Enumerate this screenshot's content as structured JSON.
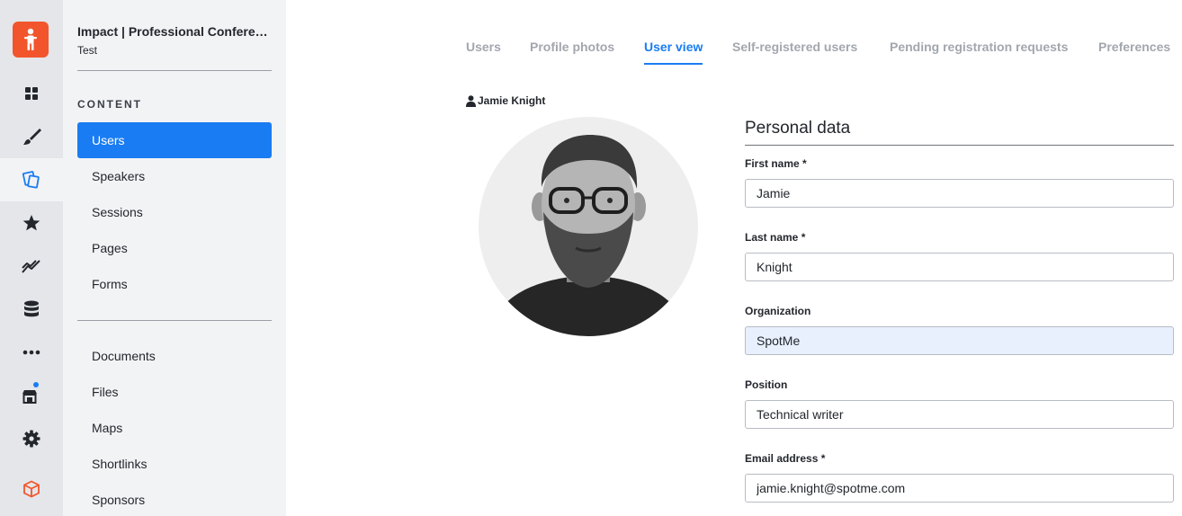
{
  "app": {
    "event_name": "Impact | Professional Conference",
    "event_subtitle": "Test"
  },
  "rail": {
    "items": [
      {
        "icon": "dashboard-grid-icon",
        "active": false
      },
      {
        "icon": "paintbrush-icon",
        "active": false
      },
      {
        "icon": "content-pages-icon",
        "active": true
      },
      {
        "icon": "star-icon",
        "active": false
      },
      {
        "icon": "analytics-chart-icon",
        "active": false
      },
      {
        "icon": "database-icon",
        "active": false
      },
      {
        "icon": "more-dots-icon",
        "active": false
      },
      {
        "icon": "marketplace-store-icon",
        "active": false,
        "has_notification": true
      },
      {
        "icon": "gear-icon",
        "active": false
      },
      {
        "icon": "package-cube-icon",
        "active": false
      }
    ],
    "accent": "#f2552c"
  },
  "sidebar": {
    "section_label": "CONTENT",
    "items": [
      {
        "label": "Users",
        "active": true
      },
      {
        "label": "Speakers"
      },
      {
        "label": "Sessions"
      },
      {
        "label": "Pages"
      },
      {
        "label": "Forms"
      }
    ],
    "items2": [
      {
        "label": "Documents"
      },
      {
        "label": "Files"
      },
      {
        "label": "Maps"
      },
      {
        "label": "Shortlinks"
      },
      {
        "label": "Sponsors"
      }
    ]
  },
  "tabs": [
    {
      "label": "Users"
    },
    {
      "label": "Profile photos"
    },
    {
      "label": "User view",
      "active": true
    },
    {
      "label": "Self-registered users"
    },
    {
      "label": "Pending registration requests"
    },
    {
      "label": "Preferences"
    }
  ],
  "user": {
    "display_name": "Jamie Knight"
  },
  "form": {
    "title": "Personal data",
    "fields": [
      {
        "label": "First name *",
        "value": "Jamie"
      },
      {
        "label": "Last name *",
        "value": "Knight"
      },
      {
        "label": "Organization",
        "value": "SpotMe"
      },
      {
        "label": "Position",
        "value": "Technical writer"
      },
      {
        "label": "Email address *",
        "value": "jamie.knight@spotme.com"
      }
    ]
  },
  "colors": {
    "accent_blue": "#1a7cf2",
    "brand_orange": "#f2552c"
  }
}
